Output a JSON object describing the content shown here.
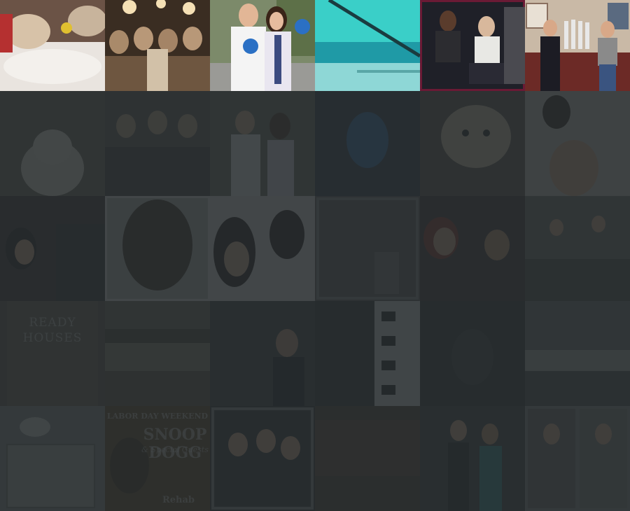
{
  "gallery": {
    "featured_row": [
      {
        "id": "photo-01",
        "subject": "pets-on-bed"
      },
      {
        "id": "photo-02",
        "subject": "fans-crowd-sepia"
      },
      {
        "id": "photo-03",
        "subject": "interview-with-paddles"
      },
      {
        "id": "photo-04",
        "subject": "ocean-view"
      },
      {
        "id": "photo-05",
        "subject": "studio-pair"
      },
      {
        "id": "photo-06",
        "subject": "trophy-room-pair"
      }
    ],
    "poster_text": {
      "book_title": "READY HOUSES",
      "flyer_header": "LABOR DAY WEEKEND",
      "flyer_name": "SNOOP DOGG",
      "flyer_sub": "& Special Guests",
      "flyer_footer": "Rehab"
    }
  }
}
